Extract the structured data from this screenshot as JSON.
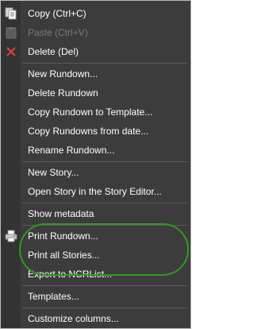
{
  "menu": {
    "groups": [
      [
        {
          "label": "Copy (Ctrl+C)",
          "icon": "copy-icon",
          "enabled": true
        },
        {
          "label": "Paste (Ctrl+V)",
          "icon": "paste-icon",
          "enabled": false
        },
        {
          "label": "Delete (Del)",
          "icon": "delete-icon",
          "enabled": true
        }
      ],
      [
        {
          "label": "New Rundown...",
          "enabled": true
        },
        {
          "label": "Delete Rundown",
          "enabled": true
        },
        {
          "label": "Copy Rundown to Template...",
          "enabled": true
        },
        {
          "label": "Copy Rundowns from date...",
          "enabled": true
        },
        {
          "label": "Rename Rundown...",
          "enabled": true
        }
      ],
      [
        {
          "label": "New Story...",
          "enabled": true
        },
        {
          "label": "Open Story in the Story Editor...",
          "enabled": true
        }
      ],
      [
        {
          "label": "Show metadata",
          "enabled": true
        }
      ],
      [
        {
          "label": "Print Rundown...",
          "icon": "printer-icon",
          "enabled": true
        },
        {
          "label": "Print all Stories...",
          "enabled": true
        },
        {
          "label": "Export to NCRList...",
          "enabled": true
        }
      ],
      [
        {
          "label": "Templates...",
          "enabled": true
        }
      ],
      [
        {
          "label": "Customize columns...",
          "enabled": true
        }
      ]
    ]
  },
  "colors": {
    "background": "#3c3c3c",
    "text": "#ffffff",
    "disabled_text": "#7a7a7a",
    "highlight_annotation": "#2f9a20",
    "delete_icon": "#e0443c"
  }
}
